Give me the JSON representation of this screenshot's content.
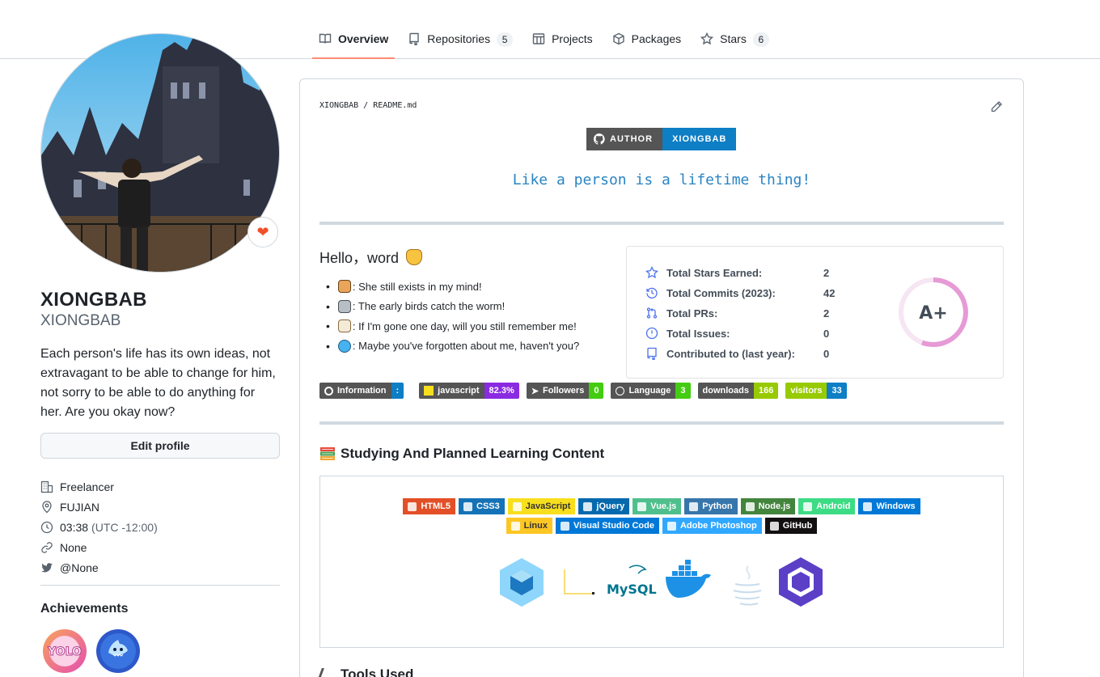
{
  "nav": {
    "tabs": [
      {
        "label": "Overview",
        "count": ""
      },
      {
        "label": "Repositories",
        "count": "5"
      },
      {
        "label": "Projects",
        "count": ""
      },
      {
        "label": "Packages",
        "count": ""
      },
      {
        "label": "Stars",
        "count": "6"
      }
    ]
  },
  "profile": {
    "name": "XIONGBAB",
    "login": "XIONGBAB",
    "bio": "Each person's life has its own ideas, not extravagant to be able to change for him, not sorry to be able to do anything for her. Are you okay now?",
    "edit_label": "Edit profile",
    "company": "Freelancer",
    "location": "FUJIAN",
    "time": "03:38",
    "timezone": "(UTC -12:00)",
    "website": "None",
    "twitter": "@None",
    "achievements_title": "Achievements"
  },
  "readme": {
    "path": "XIONGBAB / README.md",
    "author_label": "AUTHOR",
    "author_value": "XIONGBAB",
    "tagline": "Like a person is a lifetime thing!",
    "hello_title": "Hello，word",
    "hello_items": [
      ": She still exists in my mind!",
      ": The early birds catch the worm!",
      ": If I'm gone one day, will you still remember me!",
      ": Maybe you've forgotten about me, haven't you?"
    ],
    "stats": [
      {
        "label": "Total Stars Earned:",
        "value": "2",
        "icon": "star-icon"
      },
      {
        "label": "Total Commits (2023):",
        "value": "42",
        "icon": "history-icon"
      },
      {
        "label": "Total PRs:",
        "value": "2",
        "icon": "pull-request-icon"
      },
      {
        "label": "Total Issues:",
        "value": "0",
        "icon": "issue-icon"
      },
      {
        "label": "Contributed to (last year):",
        "value": "0",
        "icon": "repo-icon"
      }
    ],
    "grade": "A+",
    "shields": [
      {
        "label": "Information",
        "value": ":",
        "color": "#0e7ec5"
      },
      {
        "label": "javascript",
        "value": "82.3%",
        "color": "#8a2be2"
      },
      {
        "label": "Followers",
        "value": "0",
        "color": "#4c1"
      },
      {
        "label": "Language",
        "value": "3",
        "color": "#4c1"
      },
      {
        "label": "downloads",
        "value": "166",
        "color": "#97ca00"
      },
      {
        "label": "visitors",
        "value": "33",
        "color": "#0e7ec5"
      }
    ],
    "learning_title": "Studying And Planned Learning Content",
    "skills_row1": [
      {
        "label": "HTML5",
        "color": "#e34f26"
      },
      {
        "label": "CSS3",
        "color": "#1572b6"
      },
      {
        "label": "JavaScript",
        "color": "#f7df1e",
        "text": "#333333"
      },
      {
        "label": "jQuery",
        "color": "#0769ad"
      },
      {
        "label": "Vue.js",
        "color": "#4fc08d"
      },
      {
        "label": "Python",
        "color": "#3776ab"
      },
      {
        "label": "Node.js",
        "color": "#43853d"
      },
      {
        "label": "Android",
        "color": "#3ddc84"
      },
      {
        "label": "Windows",
        "color": "#0078d6"
      }
    ],
    "skills_row2": [
      {
        "label": "Linux",
        "color": "#fcc624",
        "text": "#333333"
      },
      {
        "label": "Visual Studio Code",
        "color": "#0078d7"
      },
      {
        "label": "Adobe Photoshop",
        "color": "#31a8ff"
      },
      {
        "label": "GitHub",
        "color": "#121011"
      }
    ],
    "logo_mysql": "MySQL",
    "tools_title": "Tools Used"
  }
}
